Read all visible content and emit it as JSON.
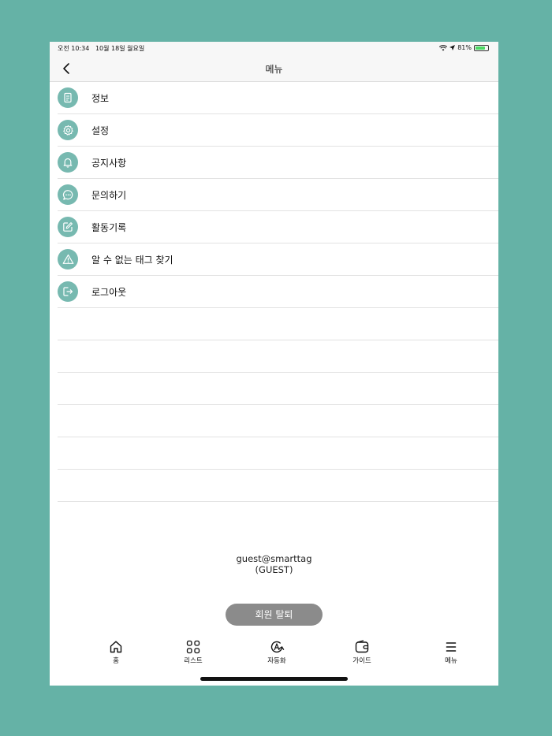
{
  "status_bar": {
    "time": "오전 10:34",
    "date": "10월 18일 월요일",
    "battery": "81%"
  },
  "nav": {
    "title": "메뉴"
  },
  "menu_items": [
    {
      "label": "정보",
      "icon": "document-icon"
    },
    {
      "label": "설정",
      "icon": "gear-icon"
    },
    {
      "label": "공지사항",
      "icon": "bell-icon"
    },
    {
      "label": "문의하기",
      "icon": "chat-bubble-icon"
    },
    {
      "label": "활동기록",
      "icon": "edit-icon"
    },
    {
      "label": "알 수 없는 태그 찾기",
      "icon": "warning-icon"
    },
    {
      "label": "로그아웃",
      "icon": "logout-icon"
    }
  ],
  "account": {
    "email": "guest@smarttag",
    "role": "(GUEST)"
  },
  "withdraw_button": "회원 탈퇴",
  "tabs": [
    {
      "label": "홈",
      "icon": "home-icon"
    },
    {
      "label": "리스트",
      "icon": "grid-icon"
    },
    {
      "label": "자동화",
      "icon": "automation-icon"
    },
    {
      "label": "가이드",
      "icon": "wallet-icon"
    },
    {
      "label": "메뉴",
      "icon": "hamburger-menu-icon"
    }
  ],
  "colors": {
    "background": "#65b2a6",
    "icon_circle": "#77b9b0",
    "button": "#8b8b8b"
  }
}
